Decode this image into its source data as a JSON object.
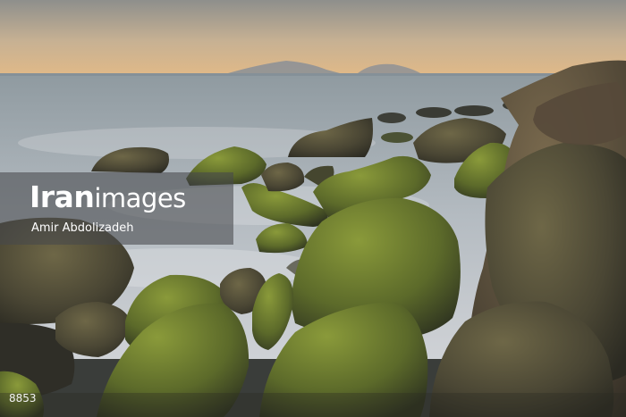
{
  "watermark": {
    "brand_part1": "Iran",
    "brand_part2": "images",
    "author": "Amir Abdolizadeh"
  },
  "photo_id": "8853",
  "scene": {
    "description_tags": [
      "sky-gradient",
      "sea",
      "distant-islands",
      "moss-covered-rocks"
    ],
    "colors": {
      "sky_top": "#8e8f8c",
      "sky_horizon": "#e0b988",
      "sea_far": "#9ea6ab",
      "sea_near": "#c9ccd0",
      "rock_dark": "#3b3a2f",
      "rock_mid": "#6a6040",
      "moss": "#7a8a2e"
    }
  }
}
